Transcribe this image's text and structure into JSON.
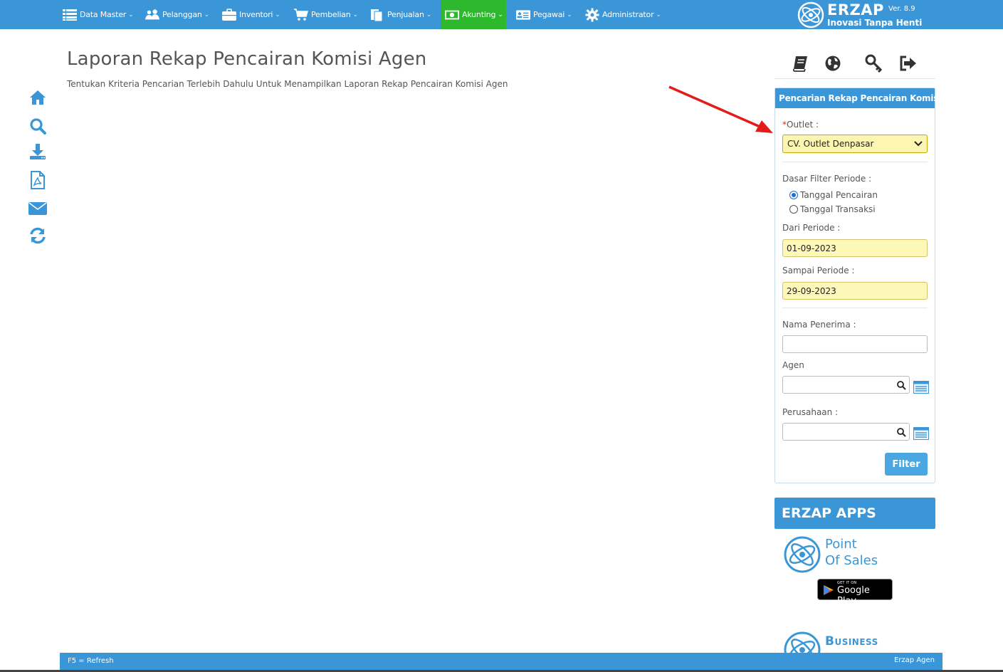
{
  "nav": {
    "items": [
      {
        "label": "Data Master",
        "icon": "list-icon"
      },
      {
        "label": "Pelanggan",
        "icon": "users-icon"
      },
      {
        "label": "Inventori",
        "icon": "briefcase-icon"
      },
      {
        "label": "Pembelian",
        "icon": "cart-icon"
      },
      {
        "label": "Penjualan",
        "icon": "document-icon"
      },
      {
        "label": "Akunting",
        "icon": "money-icon",
        "active": true
      },
      {
        "label": "Pegawai",
        "icon": "id-card-icon"
      },
      {
        "label": "Administrator",
        "icon": "gear-icon"
      }
    ],
    "active_color": "#2db82d"
  },
  "brand": {
    "name": "ERZAP",
    "version": "Ver. 8.9",
    "tagline": "Inovasi Tanpa Henti"
  },
  "page": {
    "title": "Laporan Rekap Pencairan Komisi Agen",
    "subtitle": "Tentukan Kriteria Pencarian Terlebih Dahulu Untuk Menampilkan Laporan Rekap Pencairan Komisi Agen"
  },
  "left_toolbar": [
    "home-icon",
    "search-icon",
    "download-icon",
    "pdf-icon",
    "email-icon",
    "refresh-icon"
  ],
  "right_toolbar": [
    "book-icon",
    "globe-icon",
    "key-icon",
    "logout-icon"
  ],
  "search_panel": {
    "title": "Pencarian Rekap Pencairan Komisi",
    "outlet_required_mark": "*",
    "outlet_label": "Outlet :",
    "outlet_value": "CV. Outlet Denpasar",
    "periode_basis_label": "Dasar Filter Periode :",
    "periode_options": [
      {
        "label": "Tanggal Pencairan",
        "checked": true
      },
      {
        "label": "Tanggal Transaksi",
        "checked": false
      }
    ],
    "dari_label": "Dari Periode :",
    "dari_value": "01-09-2023",
    "sampai_label": "Sampai Periode :",
    "sampai_value": "29-09-2023",
    "penerima_label": "Nama Penerima :",
    "penerima_value": "",
    "agen_label": "Agen",
    "agen_value": "",
    "perusahaan_label": "Perusahaan :",
    "perusahaan_value": "",
    "filter_label": "Filter"
  },
  "apps": {
    "title": "ERZAP APPS",
    "pos_line1": "Point",
    "pos_line2": "Of Sales",
    "gplay_small": "GET IT ON",
    "gplay_big": "Google Play",
    "business": "Business"
  },
  "footer": {
    "left": "F5 = Refresh",
    "right": "Erzap Agen"
  },
  "colors": {
    "primary": "#3a96d6",
    "highlight_input": "#fdf7b8",
    "arrow": "#e31b1b"
  }
}
